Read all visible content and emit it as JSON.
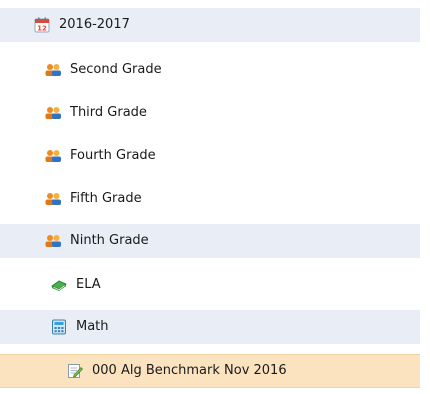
{
  "tree": {
    "year": {
      "label": "2016-2017",
      "icon": "calendar-icon"
    },
    "grades": [
      {
        "label": "Second Grade",
        "icon": "users-icon"
      },
      {
        "label": "Third Grade",
        "icon": "users-icon"
      },
      {
        "label": "Fourth Grade",
        "icon": "users-icon"
      },
      {
        "label": "Fifth Grade",
        "icon": "users-icon"
      },
      {
        "label": "Ninth Grade",
        "icon": "users-icon"
      }
    ],
    "subjects": [
      {
        "label": "ELA",
        "icon": "book-icon"
      },
      {
        "label": "Math",
        "icon": "calculator-icon"
      }
    ],
    "assessment": {
      "label": "000 Alg Benchmark Nov 2016",
      "icon": "edit-document-icon",
      "selected": true
    }
  },
  "colors": {
    "alt_row": "#e8edf6",
    "selected_row": "#fbe3c0"
  }
}
